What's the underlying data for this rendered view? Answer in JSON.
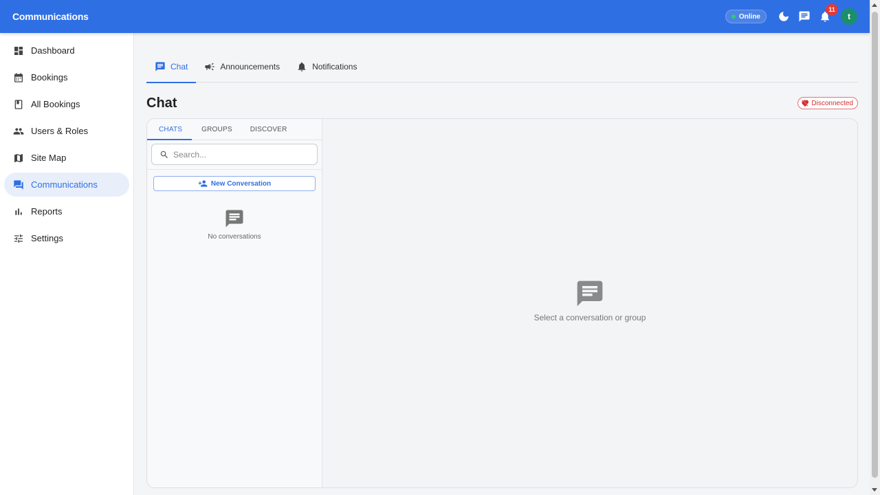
{
  "appbar": {
    "title": "Communications",
    "status": "Online",
    "notification_count": "11",
    "avatar_initial": "t"
  },
  "sidebar": {
    "items": [
      {
        "label": "Dashboard",
        "icon": "dashboard-icon"
      },
      {
        "label": "Bookings",
        "icon": "calendar-icon"
      },
      {
        "label": "All Bookings",
        "icon": "list-book-icon"
      },
      {
        "label": "Users & Roles",
        "icon": "people-icon"
      },
      {
        "label": "Site Map",
        "icon": "map-icon"
      },
      {
        "label": "Communications",
        "icon": "forum-icon",
        "active": true
      },
      {
        "label": "Reports",
        "icon": "bar-chart-icon"
      },
      {
        "label": "Settings",
        "icon": "tune-icon"
      }
    ]
  },
  "tabs": [
    {
      "label": "Chat",
      "icon": "chat-icon",
      "active": true
    },
    {
      "label": "Announcements",
      "icon": "campaign-icon"
    },
    {
      "label": "Notifications",
      "icon": "bell-icon"
    }
  ],
  "page": {
    "title": "Chat",
    "connection_status": "Disconnected"
  },
  "chat": {
    "subtabs": [
      "CHATS",
      "GROUPS",
      "DISCOVER"
    ],
    "search_placeholder": "Search...",
    "new_conversation_label": "New Conversation",
    "empty_list_text": "No conversations",
    "empty_pane_text": "Select a conversation or group"
  },
  "colors": {
    "primary": "#2f6fe4",
    "online": "#2ecc71",
    "badge": "#e53935",
    "avatar": "#1a8f6a",
    "disconnected": "#d32f2f"
  }
}
